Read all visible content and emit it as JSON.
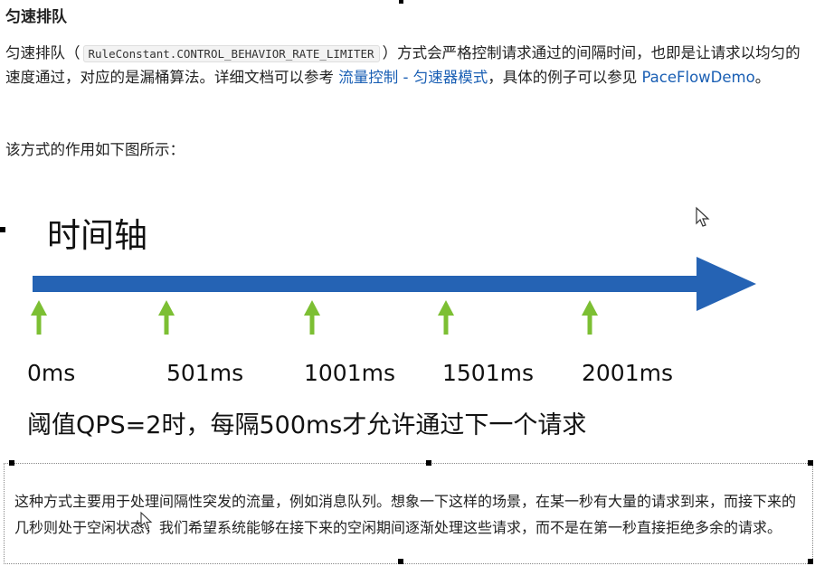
{
  "heading": "匀速排队",
  "p1": {
    "before": "匀速排队（",
    "code": "RuleConstant.CONTROL_BEHAVIOR_RATE_LIMITER",
    "middle": "）方式会严格控制请求通过的间隔时间，也即是让请求以均匀的速度通过，对应的是漏桶算法。详细文档可以参考",
    "link1": "流量控制 - 匀速器模式",
    "after_link1": "，具体的例子可以参见",
    "link2": "PaceFlowDemo",
    "end": "。"
  },
  "p2": "该方式的作用如下图所示：",
  "diagram": {
    "title": "时间轴",
    "ticks": [
      "0ms",
      "501ms",
      "1001ms",
      "1501ms",
      "2001ms"
    ],
    "note": "阈值QPS=2时，每隔500ms才允许通过下一个请求",
    "colors": {
      "axis": "#2563b4",
      "tick_arrow": "#7cbf33"
    }
  },
  "p3": "这种方式主要用于处理间隔性突发的流量，例如消息队列。想象一下这样的场景，在某一秒有大量的请求到来，而接下来的几秒则处于空闲状态，我们希望系统能够在接下来的空闲期间逐渐处理这些请求，而不是在第一秒直接拒绝多余的请求。"
}
